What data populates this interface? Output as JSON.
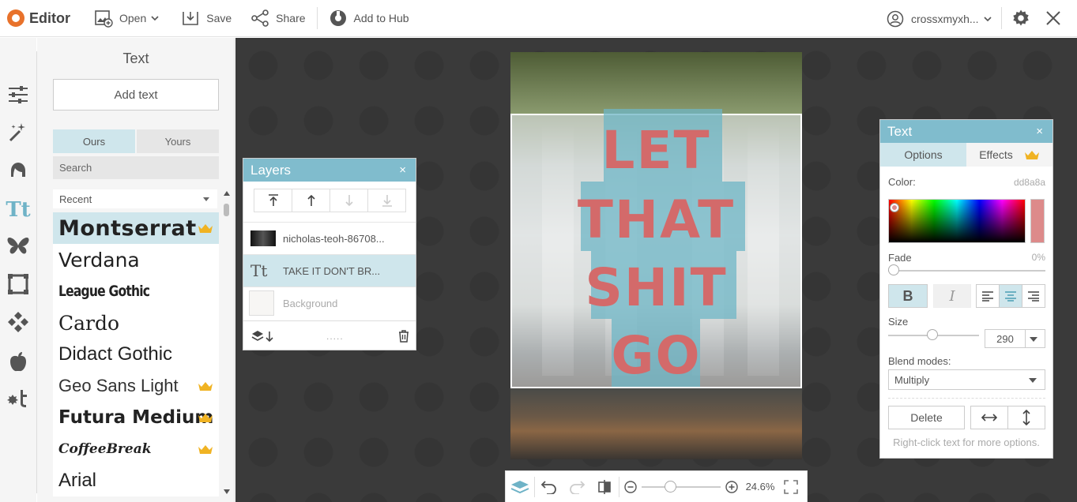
{
  "app": {
    "title": "Editor",
    "brand_color": "#e8722b"
  },
  "toolbar": {
    "open_label": "Open",
    "save_label": "Save",
    "share_label": "Share",
    "hub_label": "Add to Hub",
    "user_name": "crossxmyxh..."
  },
  "rail": {
    "icons": [
      "adjustments-icon",
      "magic-wand-icon",
      "face-icon",
      "text-icon",
      "butterfly-icon",
      "frame-icon",
      "texture-icon",
      "apple-icon",
      "graphic-icon"
    ],
    "text_glyph": "Tt"
  },
  "text_panel": {
    "title": "Text",
    "add_button": "Add text",
    "tabs": [
      "Ours",
      "Yours"
    ],
    "search_placeholder": "Search",
    "filter_selected": "Recent",
    "fonts": [
      {
        "name": "Montserrat",
        "premium": true,
        "selected": true
      },
      {
        "name": "Verdana",
        "premium": false
      },
      {
        "name": "League Gothic",
        "premium": false
      },
      {
        "name": "Cardo",
        "premium": false
      },
      {
        "name": "Didact Gothic",
        "premium": false
      },
      {
        "name": "Geo Sans Light",
        "premium": true
      },
      {
        "name": "Futura Medium",
        "premium": true
      },
      {
        "name": "CoffeeBreak",
        "premium": true
      },
      {
        "name": "Arial",
        "premium": false
      }
    ]
  },
  "canvas": {
    "lines": [
      "LET",
      "THAT",
      "SHIT",
      "GO"
    ],
    "text_color": "#dd8a8a",
    "highlight_color": "#6db5c5"
  },
  "layers_panel": {
    "title": "Layers",
    "close": "×",
    "items": [
      {
        "label": "nicholas-teoh-86708...",
        "kind": "image"
      },
      {
        "label": "TAKE IT DON'T BR...",
        "kind": "text",
        "selected": true
      },
      {
        "label": "Background",
        "kind": "background"
      }
    ],
    "text_glyph": "Tt",
    "handle": "....."
  },
  "text_props": {
    "title": "Text",
    "close": "×",
    "tabs": [
      "Options",
      "Effects"
    ],
    "color_label": "Color:",
    "color_value": "dd8a8a",
    "fade_label": "Fade",
    "fade_value": "0%",
    "fade_level": 0,
    "bold_label": "B",
    "italic_label": "I",
    "size_label": "Size",
    "size_value": "290",
    "blend_label": "Blend modes:",
    "blend_value": "Multiply",
    "delete_label": "Delete",
    "hint": "Right-click text for more options."
  },
  "bottom_bar": {
    "zoom_value": "24.6%"
  }
}
